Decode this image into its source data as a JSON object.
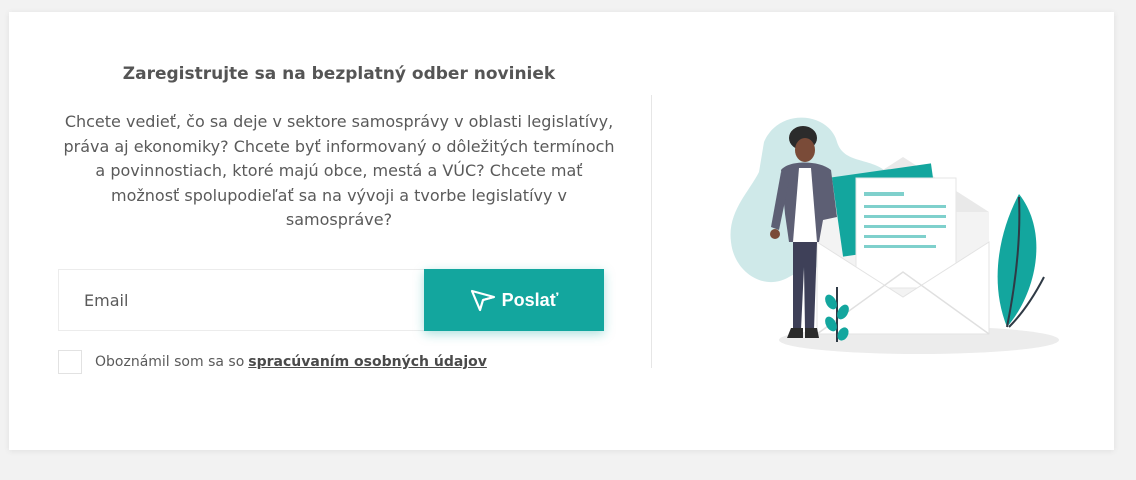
{
  "newsletter": {
    "title": "Zaregistrujte sa na bezplatný odber noviniek",
    "description": "Chcete vedieť, čo sa deje v sektore samosprávy v oblasti legislatívy, práva aj ekonomiky? Chcete byť informovaný o dôležitých termínoch a povinnostiach, ktoré majú obce, mestá a VÚC? Chcete mať možnosť spolupodieľať sa na vývoji a tvorbe legislatívy v samospráve?",
    "email_placeholder": "Email",
    "email_value": "",
    "send_label": "Poslať",
    "send_icon": "send-icon",
    "consent_text": "Oboznámil som sa so",
    "consent_link": "spracúvaním osobných údajov",
    "consent_checked": false
  },
  "colors": {
    "accent": "#13a69e",
    "text": "#5a5a5a",
    "background": "#f2f2f2"
  }
}
